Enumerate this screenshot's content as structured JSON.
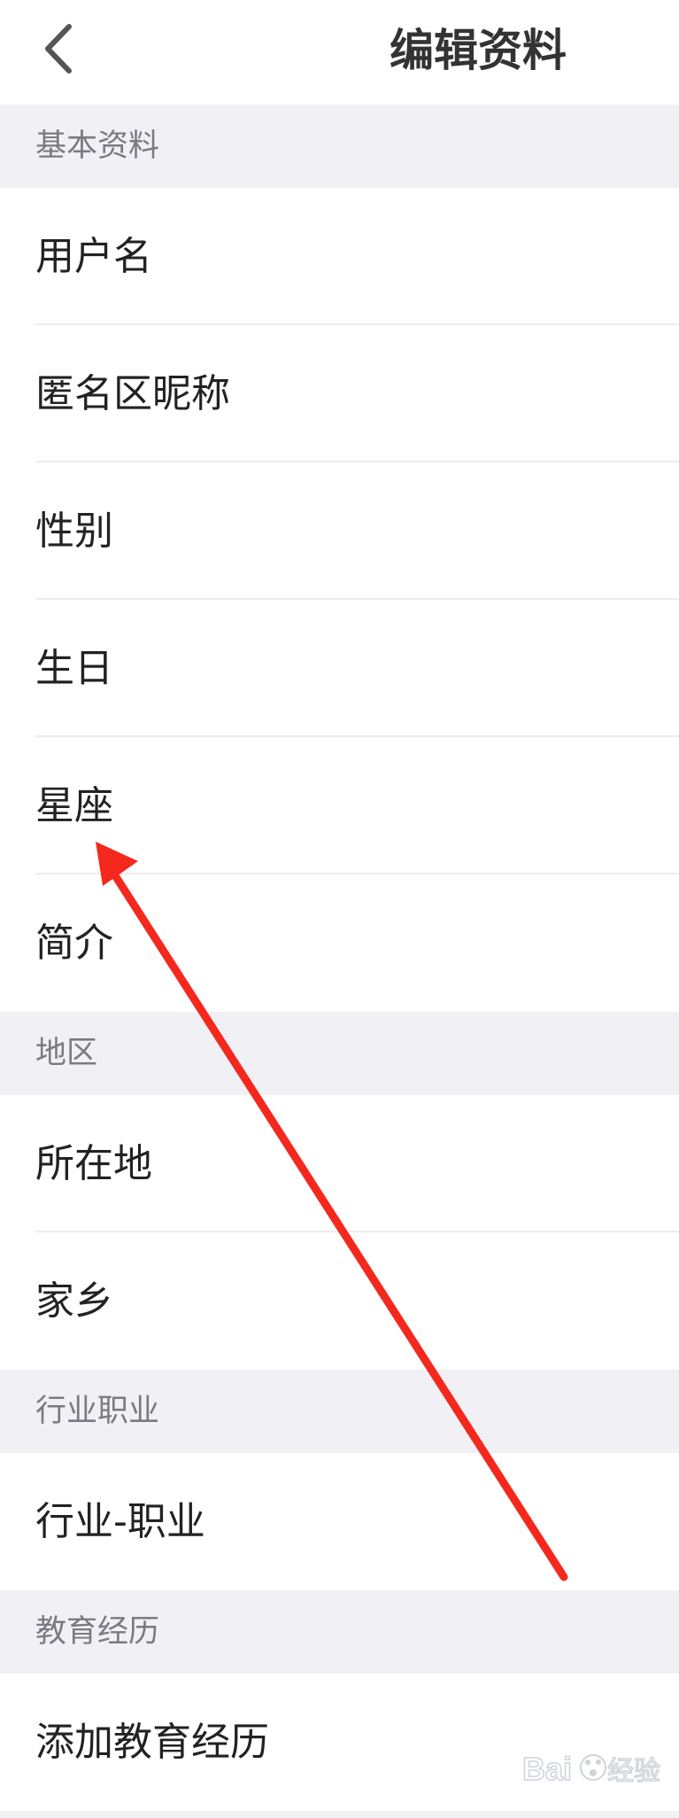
{
  "header": {
    "title": "编辑资料",
    "back_icon": "chevron-left-icon"
  },
  "sections": [
    {
      "title": "基本资料",
      "items": [
        "用户名",
        "匿名区昵称",
        "性别",
        "生日",
        "星座",
        "简介"
      ]
    },
    {
      "title": "地区",
      "items": [
        "所在地",
        "家乡"
      ]
    },
    {
      "title": "行业职业",
      "items": [
        "行业-职业"
      ]
    },
    {
      "title": "教育经历",
      "items": [
        "添加教育经历"
      ]
    }
  ],
  "overlay": {
    "arrow_color": "#f5281e"
  },
  "watermark": {
    "logo": "Baidu经验"
  },
  "colors": {
    "background": "#f1f1f5",
    "row_background": "#ffffff",
    "section_text": "#7a7a80",
    "item_text": "#222222"
  }
}
